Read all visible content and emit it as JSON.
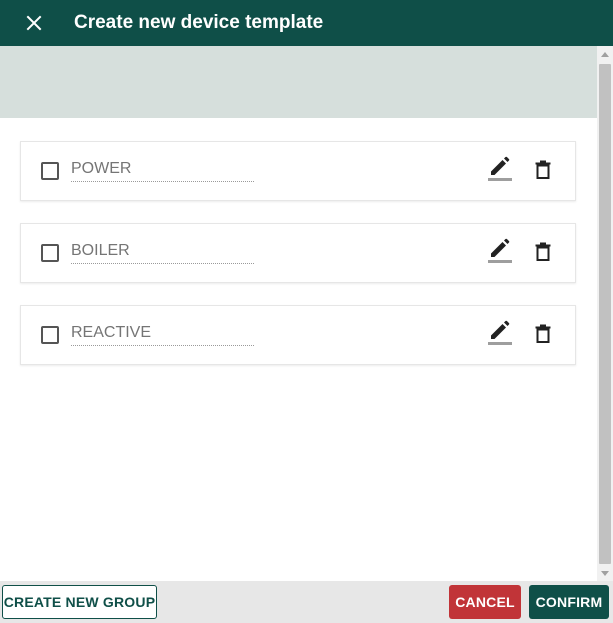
{
  "dialog": {
    "title": "Create new device template",
    "close_icon": "close-icon"
  },
  "groups": [
    {
      "placeholder": "POWER"
    },
    {
      "placeholder": "BOILER"
    },
    {
      "placeholder": "REACTIVE"
    }
  ],
  "footer": {
    "create_group_label": "CREATE NEW GROUP",
    "cancel_label": "CANCEL",
    "confirm_label": "CONFIRM"
  },
  "colors": {
    "header": "#0f4f48",
    "banner": "#d6dfdc",
    "cancel": "#c13438",
    "confirm": "#0f4f48"
  }
}
